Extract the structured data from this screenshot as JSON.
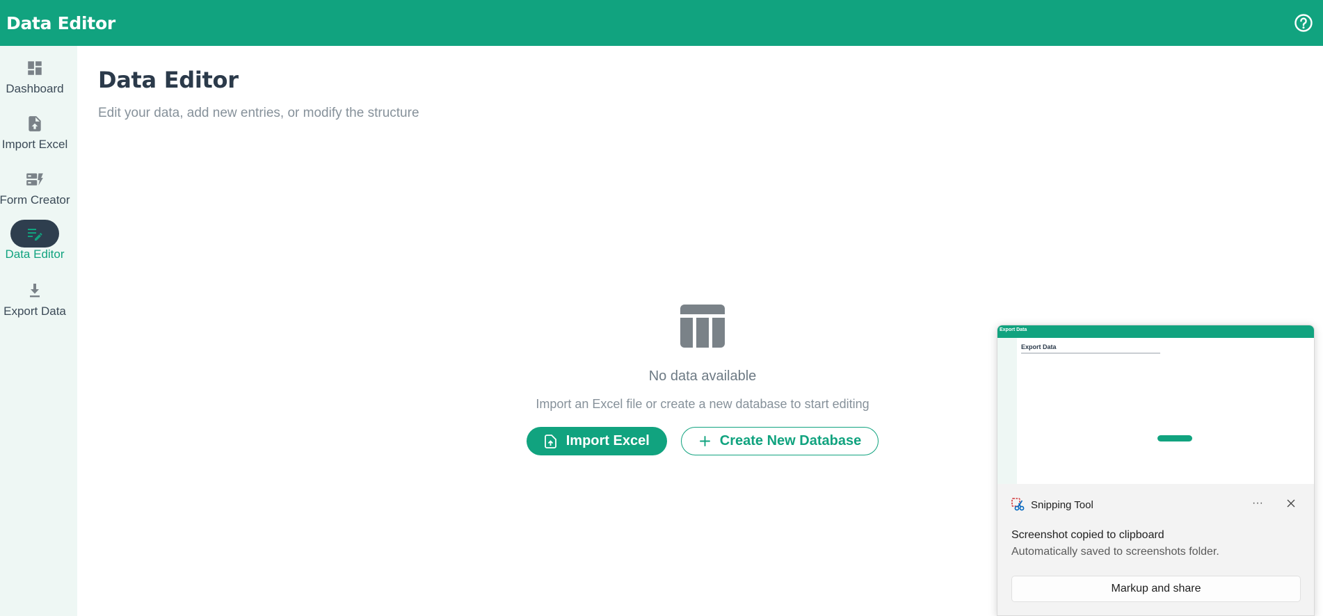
{
  "appbar": {
    "title": "Data Editor",
    "help_icon": "help-circle-icon"
  },
  "sidebar": {
    "items": [
      {
        "label": "Dashboard",
        "icon": "dashboard-icon"
      },
      {
        "label": "Import Excel",
        "icon": "file-upload-icon"
      },
      {
        "label": "Form Creator",
        "icon": "form-icon"
      },
      {
        "label": "Data Editor",
        "icon": "edit-note-icon",
        "active": true
      },
      {
        "label": "Export Data",
        "icon": "download-icon"
      }
    ]
  },
  "main": {
    "title": "Data Editor",
    "subtitle": "Edit your data, add new entries, or modify the structure"
  },
  "empty_state": {
    "icon": "table-icon",
    "title": "No data available",
    "text": "Import an Excel file or create a new database to start editing",
    "import_button": "Import Excel",
    "create_button": "Create New Database"
  },
  "toast": {
    "app_name": "Snipping Tool",
    "heading": "Screenshot copied to clipboard",
    "body": "Automatically saved to screenshots folder.",
    "action": "Markup and share",
    "more": "···",
    "thumbnail": {
      "bar_title": "Export Data",
      "title": "Export Data"
    }
  },
  "colors": {
    "accent": "#11a37f",
    "active_pill": "#2e3e4e",
    "sidebar_bg": "#eef7f4",
    "icon_gray": "#7a8288"
  }
}
